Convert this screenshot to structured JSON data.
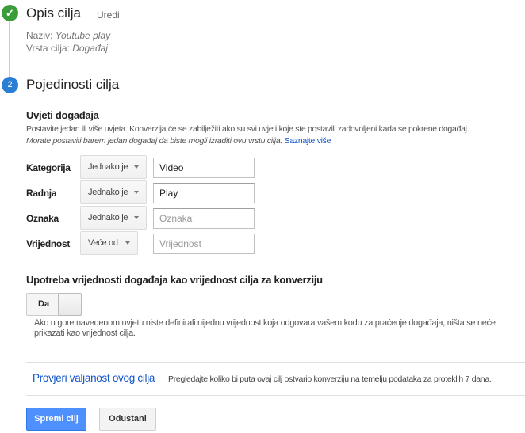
{
  "step1": {
    "number": "✓",
    "title": "Opis cilja",
    "edit": "Uredi",
    "name_label": "Naziv:",
    "name_value": "Youtube play",
    "type_label": "Vrsta cilja:",
    "type_value": "Događaj"
  },
  "step2": {
    "number": "2",
    "title": "Pojedinosti cilja"
  },
  "conditions": {
    "heading": "Uvjeti događaja",
    "description": "Postavite jedan ili više uvjeta. Konverzija će se zabilježiti ako su svi uvjeti koje ste postavili zadovoljeni kada se pokrene događaj.",
    "note": "Morate postaviti barem jedan događaj da biste mogli izraditi ovu vrstu cilja.",
    "learn_more": "Saznajte više",
    "rows": [
      {
        "label": "Kategorija",
        "operator": "Jednako je",
        "value": "Video",
        "placeholder": ""
      },
      {
        "label": "Radnja",
        "operator": "Jednako je",
        "value": "Play",
        "placeholder": ""
      },
      {
        "label": "Oznaka",
        "operator": "Jednako je",
        "value": "",
        "placeholder": "Oznaka"
      },
      {
        "label": "Vrijednost",
        "operator": "Veće od",
        "value": "",
        "placeholder": "Vrijednost"
      }
    ]
  },
  "value_section": {
    "heading": "Upotreba vrijednosti događaja kao vrijednost cilja za konverziju",
    "toggle_label": "Da",
    "toggle_on": true,
    "note_line1": "Ako u gore navedenom uvjetu niste definirali nijednu vrijednost koja odgovara vašem kodu za praćenje događaja, ništa se neće",
    "note_line2": "prikazati kao vrijednost cilja."
  },
  "verify": {
    "link": "Provjeri valjanost ovog cilja",
    "description": "Pregledajte koliko bi puta ovaj cilj ostvario konverziju na temelju podataka za proteklih 7 dana."
  },
  "actions": {
    "save": "Spremi cilj",
    "cancel": "Odustani"
  },
  "colors": {
    "accent": "#4d90fe",
    "link": "#15c",
    "success": "#3a9d3a",
    "step": "#2a7fd4"
  }
}
